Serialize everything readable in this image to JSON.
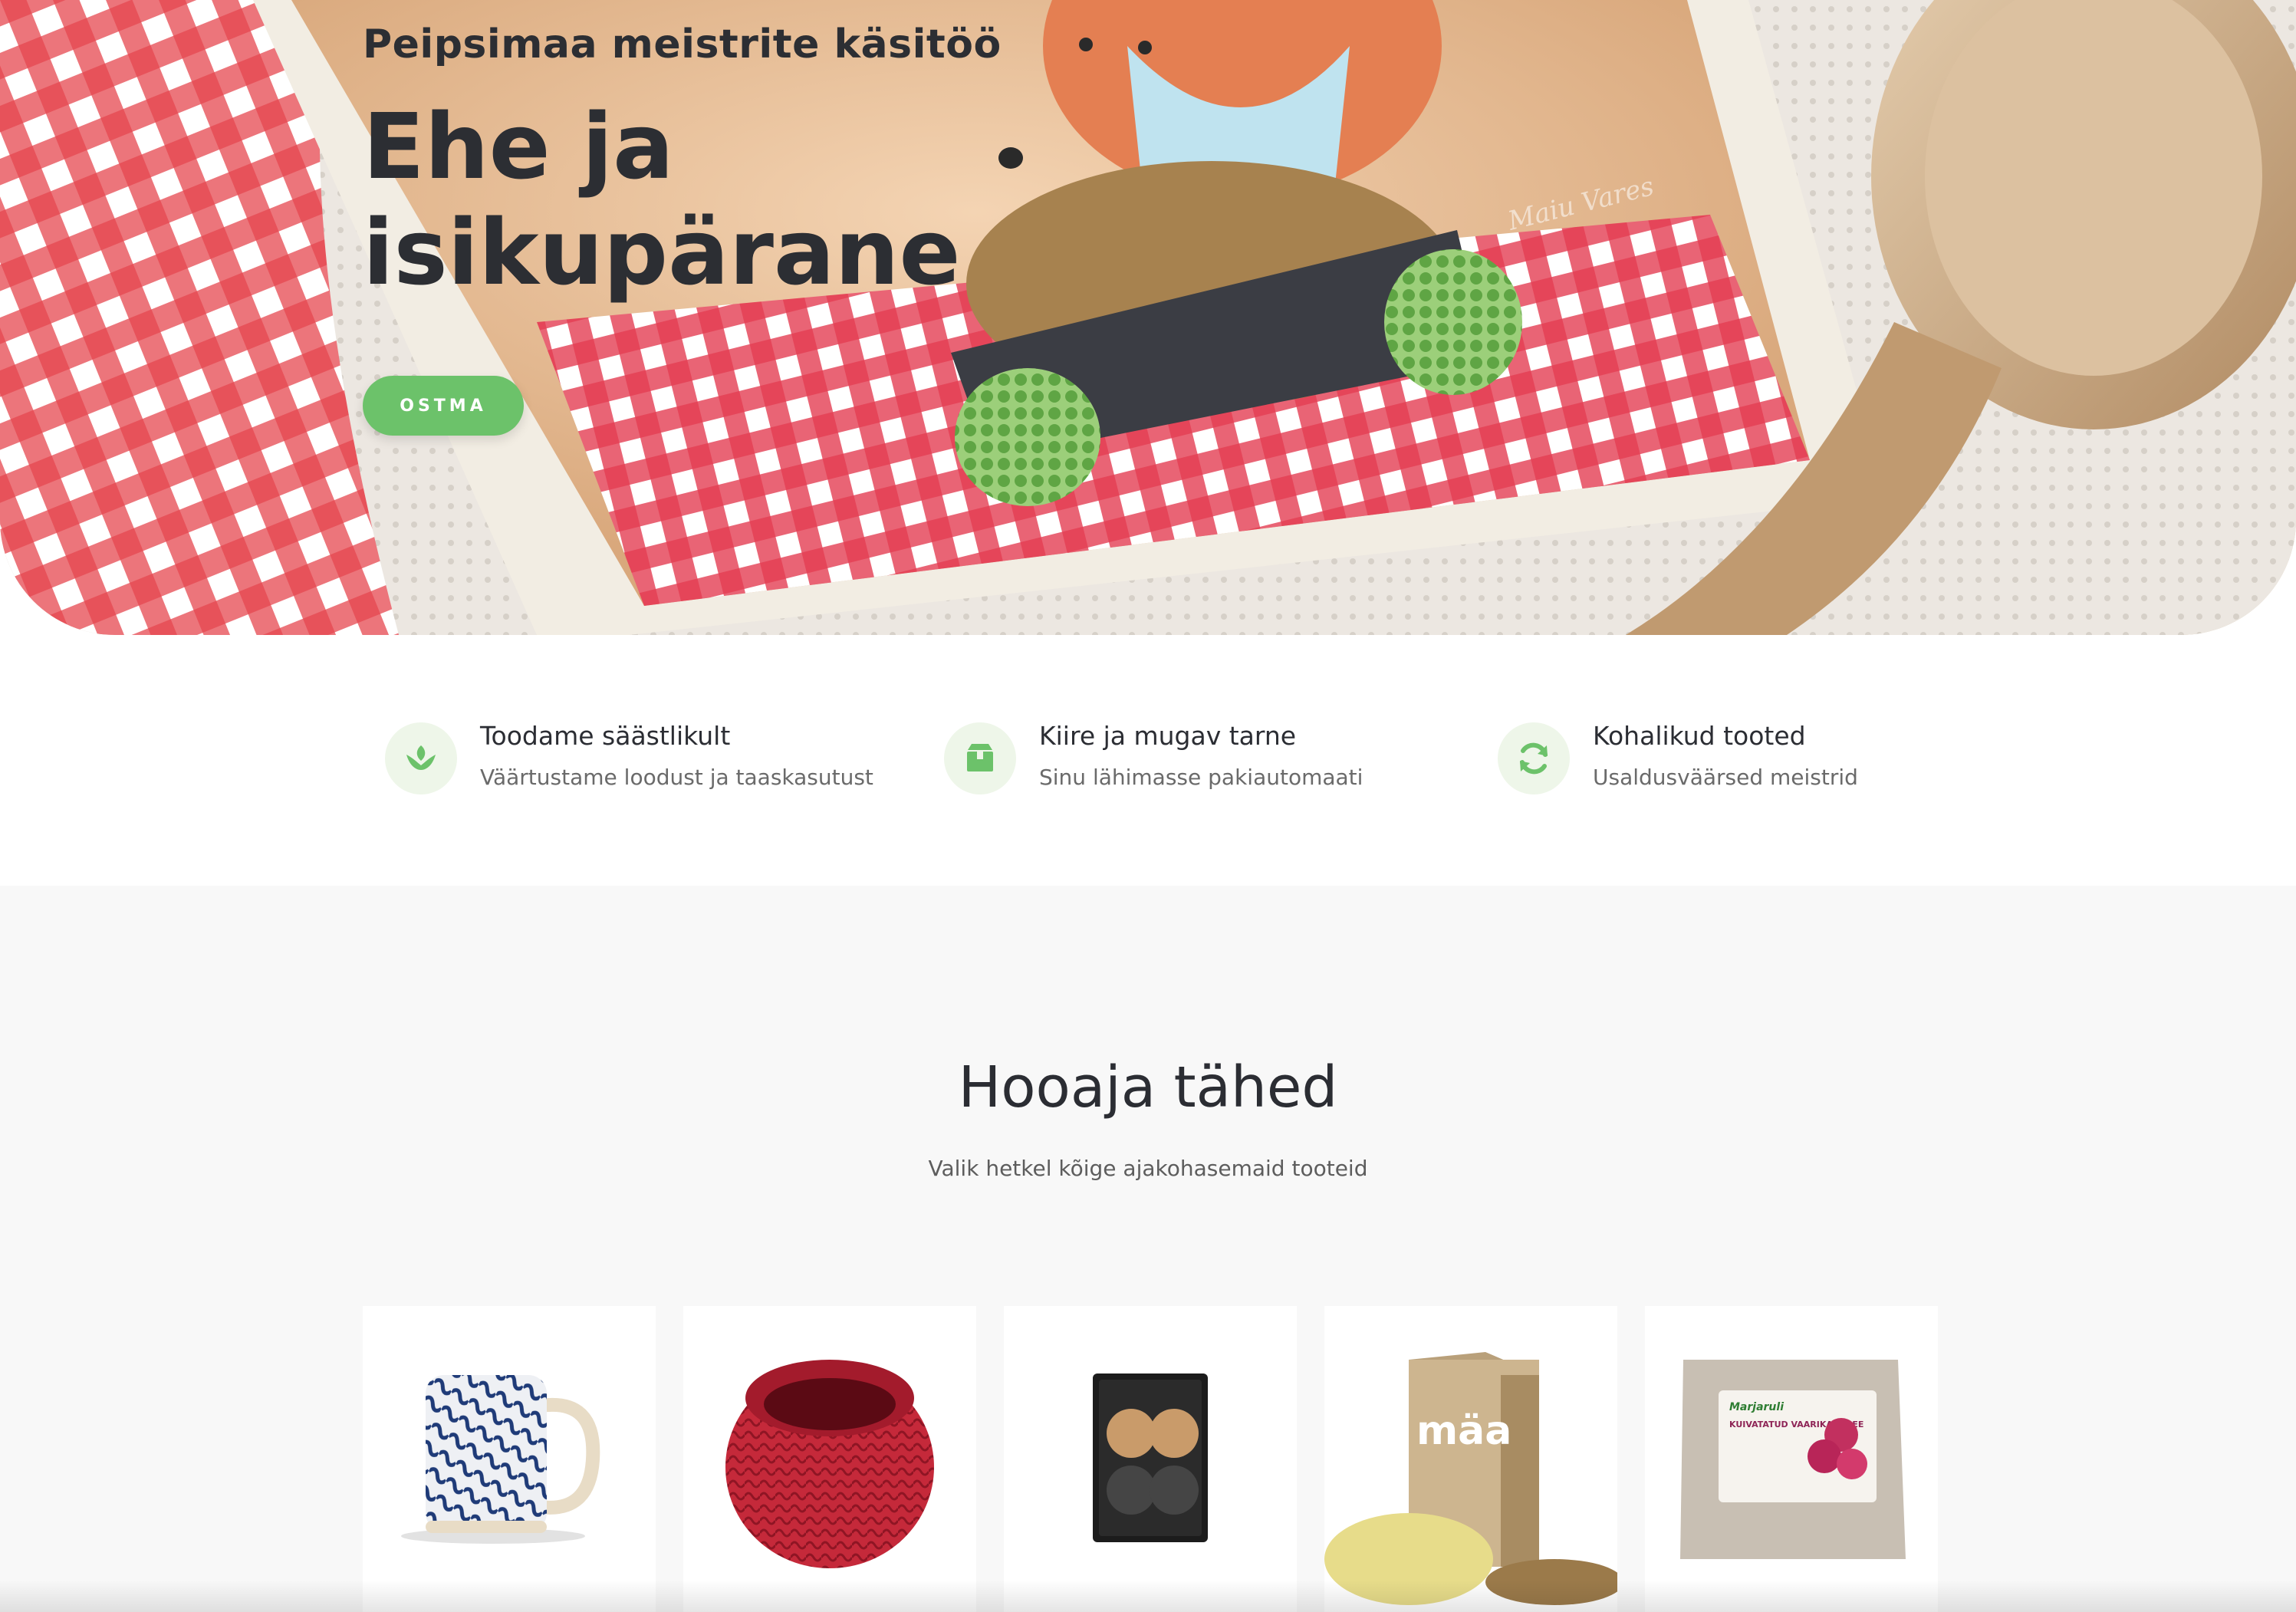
{
  "hero": {
    "subtitle": "Peipsimaa meistrite käsitöö",
    "title": "Ehe ja isikupärane",
    "button_label": "OSTMA",
    "artist_signature": "Maiu Vares"
  },
  "features": [
    {
      "icon": "leaf-icon",
      "title": "Toodame säästlikult",
      "description": "Väärtustame loodust ja taaskasutust"
    },
    {
      "icon": "box-icon",
      "title": "Kiire ja mugav tarne",
      "description": "Sinu lähimasse pakiautomaati"
    },
    {
      "icon": "refresh-icon",
      "title": "Kohalikud tooted",
      "description": "Usaldusväärsed meistrid"
    }
  ],
  "season": {
    "title": "Hooaja tähed",
    "subtitle": "Valik hetkel kõige ajakohasemaid tooteid"
  },
  "products": [
    {
      "image": "blue-leaf-mug"
    },
    {
      "image": "red-crochet-basket"
    },
    {
      "image": "button-set-box",
      "brand": ""
    },
    {
      "image": "maa-wool-pellet-box",
      "brand": "mäa"
    },
    {
      "image": "raspberry-puree-pack",
      "brand": "Marjaruli",
      "label": "KUIVATATUD VAARIKAPÜREE"
    }
  ],
  "colors": {
    "accent": "#6cc26a",
    "icon_bg": "#eef6e9",
    "text_dark": "#2b2d33",
    "section_bg": "#f8f8f8"
  }
}
